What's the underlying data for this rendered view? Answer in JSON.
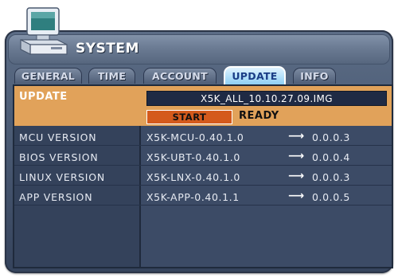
{
  "window": {
    "title": "SYSTEM",
    "icon": "computer-icon"
  },
  "tabs": [
    {
      "label": "GENERAL",
      "active": false
    },
    {
      "label": "TIME",
      "active": false
    },
    {
      "label": "ACCOUNT",
      "active": false
    },
    {
      "label": "UPDATE",
      "active": true
    },
    {
      "label": "INFO",
      "active": false
    }
  ],
  "update": {
    "label": "UPDATE",
    "image_file": "X5K_ALL_10.10.27.09.IMG",
    "start_label": "START",
    "status": "READY"
  },
  "versions": [
    {
      "label": "MCU VERSION",
      "current": "X5K-MCU-0.40.1.0",
      "arrow": "⟶",
      "target": "0.0.0.3"
    },
    {
      "label": "BIOS VERSION",
      "current": "X5K-UBT-0.40.1.0",
      "arrow": "⟶",
      "target": "0.0.0.4"
    },
    {
      "label": "LINUX VERSION",
      "current": "X5K-LNX-0.40.1.0",
      "arrow": "⟶",
      "target": "0.0.0.3"
    },
    {
      "label": "APP VERSION",
      "current": "X5K-APP-0.40.1.1",
      "arrow": "⟶",
      "target": "0.0.0.5"
    }
  ],
  "colors": {
    "highlight": "#e1a25a",
    "start_button": "#d45a1c",
    "active_tab": "#8fd0f5",
    "panel": "#3c4b66"
  }
}
